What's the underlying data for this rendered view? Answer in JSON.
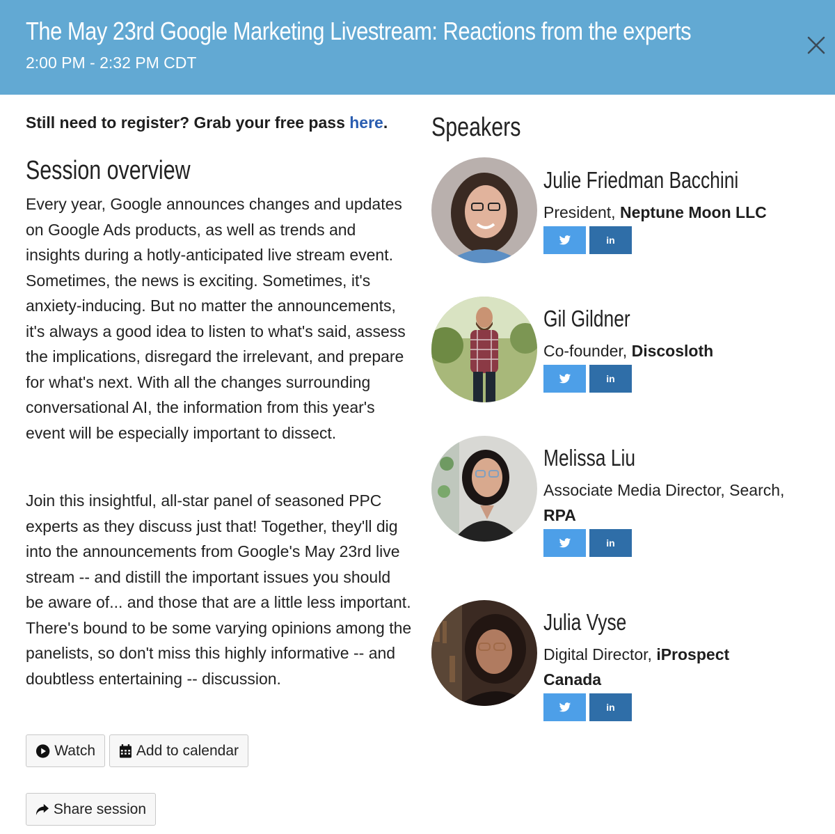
{
  "header": {
    "title": "The May 23rd Google Marketing Livestream: Reactions from the experts",
    "time": "2:00 PM - 2:32 PM CDT",
    "close_icon": "close-icon"
  },
  "register": {
    "text": "Still need to register? Grab your free pass ",
    "link": "here",
    "suffix": "."
  },
  "overview": {
    "heading": "Session overview",
    "paragraph1": "Every year, Google announces changes and updates on Google Ads products, as well as trends and insights during a hotly-anticipated live stream event. Sometimes, the news is exciting. Sometimes, it's anxiety-inducing. But no matter the announcements, it's always a good idea to listen to what's said, assess the implications, disregard the irrelevant, and prepare for what's next. With all the changes surrounding conversational AI, the information from this year's event will be especially important to dissect.",
    "paragraph2": "Join this insightful, all-star panel of seasoned PPC experts as they discuss just that! Together, they'll dig into the announcements from Google's May 23rd live stream -- and distill the important issues you should be aware of... and those that are a little less important. There's bound to be some varying opinions among the panelists, so don't miss this highly informative -- and doubtless entertaining -- discussion."
  },
  "actions": {
    "watch": "Watch",
    "calendar": "Add to calendar",
    "share": "Share session"
  },
  "speakers": {
    "heading": "Speakers",
    "list": [
      {
        "name": "Julie Friedman Bacchini",
        "title": "President, ",
        "company": "Neptune Moon LLC"
      },
      {
        "name": "Gil Gildner",
        "title": "Co-founder, ",
        "company": "Discosloth"
      },
      {
        "name": "Melissa Liu",
        "title": "Associate Media Director, Search, ",
        "company": "RPA"
      },
      {
        "name": "Julia Vyse",
        "title": "Digital Director, ",
        "company": "iProspect Canada"
      }
    ],
    "twitter_label": "twitter-icon",
    "linkedin_label": "in"
  },
  "colors": {
    "header_bg": "#62a9d3",
    "link": "#2a5db0",
    "twitter": "#4d9fe8",
    "linkedin": "#2f6ea8"
  }
}
